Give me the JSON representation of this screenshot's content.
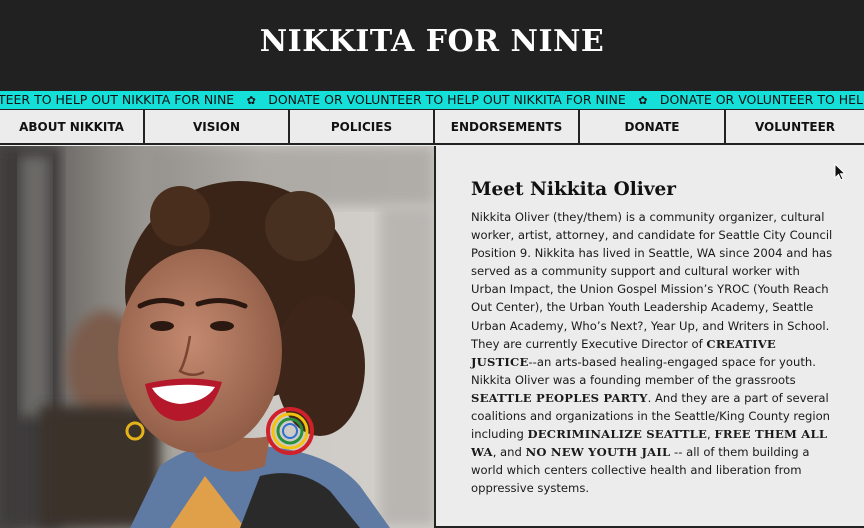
{
  "header": {
    "title": "NIKKITA FOR NINE"
  },
  "ticker": {
    "lead": "TEER TO HELP OUT NIKKITA FOR NINE",
    "message": "DONATE OR VOLUNTEER TO HELP OUT NIKKITA FOR NINE",
    "separator_icon": "flower-icon"
  },
  "nav": {
    "items": [
      {
        "label": "ABOUT NIKKITA"
      },
      {
        "label": "VISION"
      },
      {
        "label": "POLICIES"
      },
      {
        "label": "ENDORSEMENTS"
      },
      {
        "label": "DONATE"
      },
      {
        "label": "VOLUNTEER"
      }
    ]
  },
  "bio": {
    "title": "Meet Nikkita Oliver",
    "p1": "Nikkita Oliver (they/them) is a community organizer, cultural worker, artist, attorney, and candidate for Seattle City Council Position 9. Nikkita has lived in Seattle, WA since 2004 and has served as a community support and cultural worker with Urban Impact, the Union Gospel Mission’s YROC (Youth Reach Out Center), the Urban Youth Leadership Academy, Seattle Urban Academy, Who’s Next?, Year Up, and Writers in School. They are currently Executive Director of ",
    "link_creative_justice": "CREATIVE JUSTICE",
    "p2": "--an arts-based healing-engaged space for youth. Nikkita Oliver was a founding member of the grassroots ",
    "link_seattle_peoples_party": "SEATTLE PEOPLES PARTY",
    "p3": ". And they are a part of several coalitions and organizations in the Seattle/King County region including ",
    "link_decriminalize_seattle": "DECRIMINALIZE SEATTLE",
    "sep1": ", ",
    "link_free_them_all": "FREE THEM ALL WA",
    "sep2": ", and ",
    "link_no_new_youth_jail": "NO NEW YOUTH JAIL",
    "p4": " -- all of them building a world which centers collective health and liberation from oppressive systems."
  },
  "colors": {
    "header_bg": "#212121",
    "ticker_bg": "#14dfd9",
    "page_bg": "#ececec",
    "border": "#222222"
  }
}
